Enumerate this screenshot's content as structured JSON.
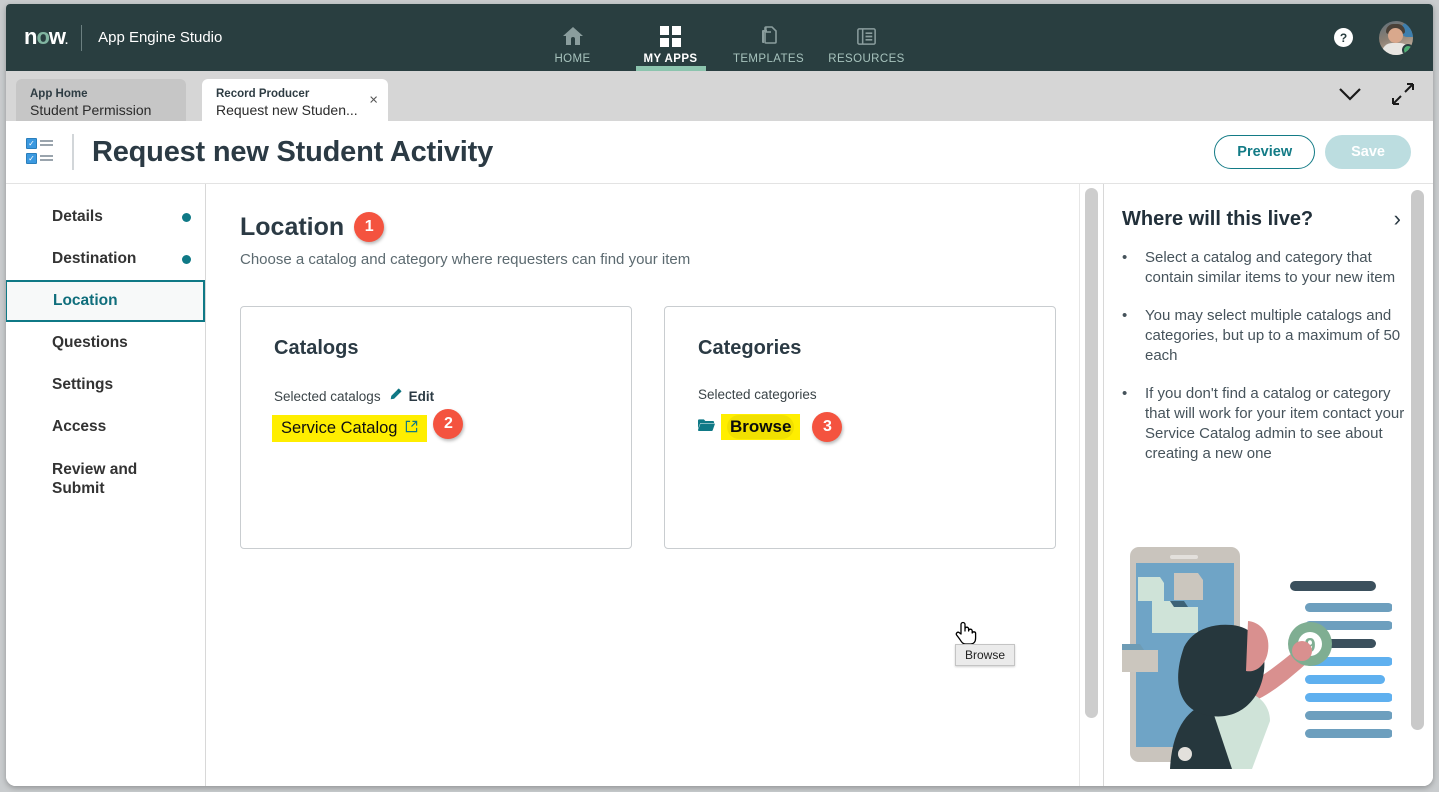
{
  "header": {
    "logo": "now",
    "app_title": "App Engine Studio",
    "nav": [
      {
        "label": "HOME",
        "icon": "home-icon",
        "active": false
      },
      {
        "label": "MY APPS",
        "icon": "grid-icon",
        "active": true
      },
      {
        "label": "TEMPLATES",
        "icon": "documents-icon",
        "active": false
      },
      {
        "label": "RESOURCES",
        "icon": "book-icon",
        "active": false
      }
    ],
    "help_label": "?",
    "avatar_label": "user-avatar"
  },
  "tabs": [
    {
      "sub": "App Home",
      "main": "Student Permission",
      "active": false
    },
    {
      "sub": "Record Producer",
      "main": "Request new Studen...",
      "active": true,
      "close": "×"
    }
  ],
  "tabstrip": {
    "chevron": "chevron-down",
    "expand": "expand-arrows"
  },
  "titlebar": {
    "title": "Request new Student Activity",
    "preview_label": "Preview",
    "save_label": "Save"
  },
  "sidebar": {
    "items": [
      {
        "label": "Details",
        "dot": true,
        "active": false
      },
      {
        "label": "Destination",
        "dot": true,
        "active": false
      },
      {
        "label": "Location",
        "dot": false,
        "active": true
      },
      {
        "label": "Questions",
        "dot": false,
        "active": false
      },
      {
        "label": "Settings",
        "dot": false,
        "active": false
      },
      {
        "label": "Access",
        "dot": false,
        "active": false
      },
      {
        "label": "Review and Submit",
        "dot": false,
        "active": false
      }
    ]
  },
  "main": {
    "section_title": "Location",
    "section_badge": "1",
    "section_subtitle": "Choose a catalog and category where requesters can find your item",
    "catalogs_card": {
      "title": "Catalogs",
      "selected_label": "Selected catalogs",
      "edit_label": "Edit",
      "selected_value": "Service Catalog",
      "badge": "2"
    },
    "categories_card": {
      "title": "Categories",
      "selected_label": "Selected categories",
      "browse_label": "Browse",
      "badge": "3",
      "tooltip": "Browse"
    }
  },
  "right_panel": {
    "title": "Where will this live?",
    "bullets": [
      "Select a catalog and category that contain similar items to your new item",
      "You may select multiple catalogs and categories, but up to a maximum of 50 each",
      "If you don't find a catalog or category that will work for your item contact your Service Catalog admin to see about creating a new one"
    ],
    "illustration_badge": "9"
  },
  "colors": {
    "header_bg": "#293e40",
    "accent_teal": "#0f7986",
    "badge_red": "#f4533f",
    "highlight_yellow": "#ffee00",
    "nav_active_underline": "#8cc4ae"
  }
}
